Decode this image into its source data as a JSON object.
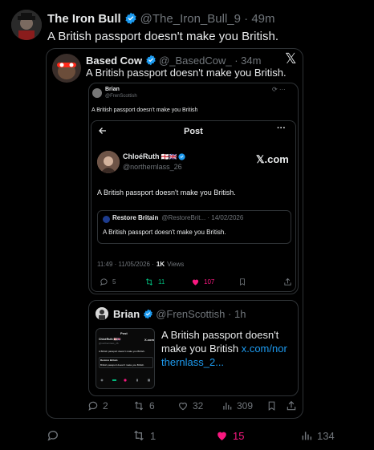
{
  "main": {
    "name": "The Iron Bull",
    "handle": "@The_Iron_Bull_9",
    "time": "49m",
    "text": "A British passport doesn't make you British.",
    "actions": {
      "replies": "",
      "reposts": "1",
      "likes": "15",
      "views": "134"
    }
  },
  "quote1": {
    "name": "Based Cow",
    "handle": "@_BasedCow_",
    "time": "34m",
    "text": "A British passport doesn't make you British.",
    "x_logo": "𝕏",
    "actions": {
      "replies": "2",
      "reposts": "6",
      "likes": "32",
      "views": "309"
    }
  },
  "img_tweet": {
    "name": "Brian",
    "handle": "@FrenScottish",
    "text": "A British passport doesn't make you British",
    "post_header": "Post",
    "inner": {
      "name": "ChloéRuth",
      "flags": "🏴󠁧󠁢󠁥󠁮󠁧󠁿🇬🇧",
      "handle": "@northernlass_26",
      "brand": "𝕏.com",
      "text": "A British passport doesn't make you British.",
      "quoted": {
        "name": "Restore Britain",
        "handle": "@RestoreBrit...",
        "date": "14/02/2026",
        "text": "A British passport doesn't make you British."
      },
      "meta_time": "11:49 · 11/05/2026 ·",
      "views_count": "1K",
      "views_label": "Views",
      "actions": {
        "replies": "5",
        "reposts": "11",
        "likes": "107"
      }
    }
  },
  "quote2": {
    "name": "Brian",
    "handle": "@FrenScottish",
    "time": "1h",
    "text": "A British passport doesn't make you British ",
    "link": "x.com/northernlass_2...",
    "thumb": {
      "header": "Post",
      "name": "ChloéRuth 🏴󠁧󠁢󠁥󠁮󠁧󠁿🇬🇧",
      "handle": "@northernlass_26",
      "brand": "X.com",
      "text": "A British passport doesn't make you British.",
      "quoted_name": "Restore Britain",
      "quoted_text": "British passport doesn't make you British."
    }
  },
  "colors": {
    "verified": "#1d9bf0",
    "like_active": "#f91880",
    "repost_green": "#00ba7c",
    "link": "#1d9bf0"
  }
}
